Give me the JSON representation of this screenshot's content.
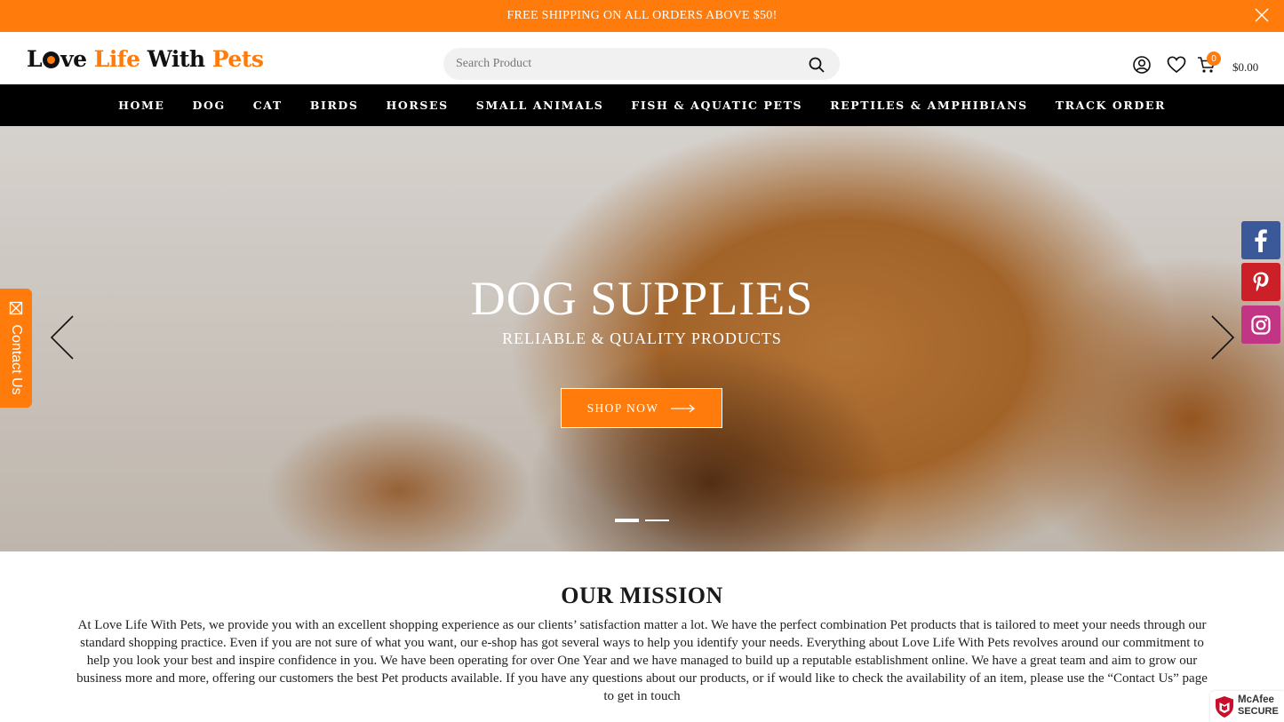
{
  "announcement": {
    "text": "FREE SHIPPING ON ALL ORDERS ABOVE $50!"
  },
  "header": {
    "logo": {
      "part1": "L",
      "part2": "ve",
      "part3": "Life",
      "part4": "With",
      "part5": "Pets"
    },
    "search": {
      "placeholder": "Search Product"
    },
    "cart": {
      "count": "0",
      "total": "$0.00"
    }
  },
  "nav": {
    "items": [
      "HOME",
      "DOG",
      "CAT",
      "BIRDS",
      "HORSES",
      "SMALL ANIMALS",
      "FISH & AQUATIC PETS",
      "REPTILES & AMPHIBIANS",
      "TRACK ORDER"
    ]
  },
  "hero": {
    "title": "DOG SUPPLIES",
    "subtitle": "RELIABLE & QUALITY PRODUCTS",
    "button_label": "SHOP NOW",
    "slide_count": 2,
    "active_slide": 1
  },
  "contact_tab": {
    "label": "Contact Us"
  },
  "social": [
    "facebook-icon",
    "pinterest-icon",
    "instagram-icon"
  ],
  "mission": {
    "title": "OUR MISSION",
    "text": "At Love Life With Pets, we provide you with an excellent shopping experience as our clients’ satisfaction matter a lot. We have the perfect combination Pet products that is tailored to meet your needs through our standard shopping practice. Even if you are not sure of what you want, our e-shop has got several ways to help you identify your needs. Everything about Love Life With Pets revolves around our commitment to help you look your best and inspire confidence in you. We have been operating for over One Year and we have managed to build up a reputable establishment online. We have a great team and aim to grow our business more and more, offering our customers the best Pet products available. If you have any questions about our products, or if would like to check the availability of an item, please use the “Contact Us” page to get in touch"
  },
  "badge": {
    "name": "McAfee",
    "secure": "SECURE"
  },
  "colors": {
    "accent": "#ff7b0b",
    "nav_bg": "#000000",
    "facebook": "#3b5998",
    "pinterest": "#cb2027",
    "instagram": "#c13584"
  }
}
